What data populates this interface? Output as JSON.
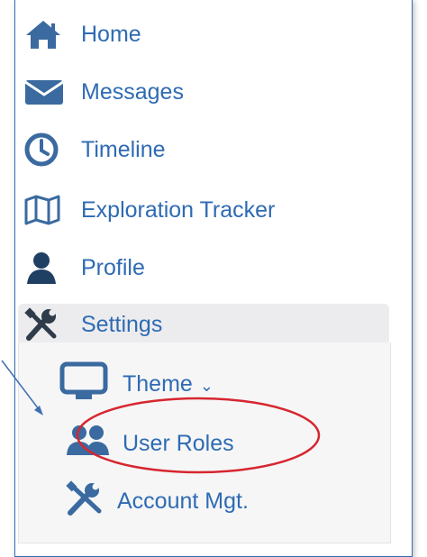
{
  "colors": {
    "link": "#2e6bb3",
    "icon": "#3a6aa0",
    "annotation": "#d7262f",
    "arrow": "#3f6fb0"
  },
  "nav": {
    "items": [
      {
        "label": "Home",
        "icon": "home-icon"
      },
      {
        "label": "Messages",
        "icon": "envelope-icon"
      },
      {
        "label": "Timeline",
        "icon": "clock-icon"
      },
      {
        "label": "Exploration Tracker",
        "icon": "map-icon"
      },
      {
        "label": "Profile",
        "icon": "user-icon"
      },
      {
        "label": "Settings",
        "icon": "wrench-screwdriver-icon"
      }
    ],
    "settings_submenu": [
      {
        "label": "Theme",
        "icon": "monitor-icon",
        "caret": "⌄"
      },
      {
        "label": "User Roles",
        "icon": "users-icon"
      },
      {
        "label": "Account Mgt.",
        "icon": "wrench-screwdriver-icon"
      }
    ]
  }
}
